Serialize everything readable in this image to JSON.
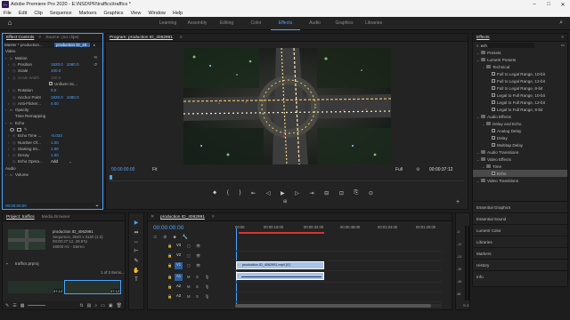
{
  "titlebar": {
    "logo": "Pr",
    "title": "Adobe Premiere Pro 2020 - E:\\NSD\\PR\\traffics\\traffics *",
    "min": "–",
    "max": "□",
    "close": "✕"
  },
  "menu": [
    "File",
    "Edit",
    "Clip",
    "Sequence",
    "Markers",
    "Graphics",
    "View",
    "Window",
    "Help"
  ],
  "workspaces": {
    "items": [
      "Learning",
      "Assembly",
      "Editing",
      "Color",
      "Effects",
      "Audio",
      "Graphics",
      "Libraries"
    ],
    "active": "Effects"
  },
  "effect_controls": {
    "tabs": [
      "Effect Controls",
      "Source: (no clips)"
    ],
    "menu_icon": "≡",
    "master_label": "Master * production...",
    "clip_label": "production ID_40...",
    "section_video": "Video",
    "motion": "Motion",
    "position": {
      "label": "Position",
      "x": "1920.0",
      "y": "1080.0"
    },
    "scale": {
      "label": "Scale",
      "value": "100.0"
    },
    "scale_width": {
      "label": "Scale Width",
      "value": "100.0"
    },
    "uniform_scale": "Uniform Sc...",
    "rotation": {
      "label": "Rotation",
      "value": "0.0"
    },
    "anchor": {
      "label": "Anchor Point",
      "x": "1920.0",
      "y": "1080.0"
    },
    "anti_flicker": {
      "label": "Anti-Flicker...",
      "value": "0.00"
    },
    "opacity": "Opacity",
    "time_remap": "Time Remapping",
    "echo": "Echo",
    "echo_time": {
      "label": "Echo Time ...",
      "value": "-0.033"
    },
    "num_echoes": {
      "label": "Number Of...",
      "value": "1.00"
    },
    "starting_int": {
      "label": "Starting Int...",
      "value": "1.00"
    },
    "decay": {
      "label": "Decay",
      "value": "1.00"
    },
    "echo_operator": {
      "label": "Echo Opera...",
      "value": "Add"
    },
    "section_audio": "Audio",
    "volume": "Volume",
    "timecode": "00:00:00:00"
  },
  "program": {
    "title": "Program: production ID_4062991",
    "menu_icon": "≡",
    "timecode_left": "00:00:00:00",
    "fit": "Fit",
    "quality": "Full",
    "timecode_right": "00:00:37:12",
    "transport": [
      "⬥",
      "{",
      "}",
      "⇤",
      "◁",
      "▶",
      "▷",
      "⇥",
      "⊟",
      "⊡",
      "⎘",
      "⊙"
    ],
    "extra": [
      "⊞",
      "+"
    ]
  },
  "effects_panel": {
    "title": "Effects",
    "menu_icon": "≡",
    "search_value": "ech",
    "rows": [
      {
        "depth": 0,
        "type": "folder",
        "label": "Presets"
      },
      {
        "depth": 0,
        "type": "folder",
        "label": "Lumetri Presets"
      },
      {
        "depth": 1,
        "type": "folder",
        "label": "Technical"
      },
      {
        "depth": 2,
        "type": "item",
        "label": "Full to Legal Range, 10-bit"
      },
      {
        "depth": 2,
        "type": "item",
        "label": "Full to Legal Range, 12-bit"
      },
      {
        "depth": 2,
        "type": "item",
        "label": "Full to Legal Range, 8-bit"
      },
      {
        "depth": 2,
        "type": "item",
        "label": "Legal to Full Range, 10-bit"
      },
      {
        "depth": 2,
        "type": "item",
        "label": "Legal to Full Range, 12-bit"
      },
      {
        "depth": 2,
        "type": "item",
        "label": "Legal to Full Range, 8-bit"
      },
      {
        "depth": 0,
        "type": "folder",
        "label": "Audio Effects"
      },
      {
        "depth": 1,
        "type": "folder",
        "label": "Delay and Echo"
      },
      {
        "depth": 2,
        "type": "item",
        "label": "Analog Delay"
      },
      {
        "depth": 2,
        "type": "item",
        "label": "Delay"
      },
      {
        "depth": 2,
        "type": "item",
        "label": "Multitap Delay"
      },
      {
        "depth": 0,
        "type": "folder",
        "label": "Audio Transitions"
      },
      {
        "depth": 0,
        "type": "folder",
        "label": "Video Effects"
      },
      {
        "depth": 1,
        "type": "folder",
        "label": "Time"
      },
      {
        "depth": 2,
        "type": "item",
        "label": "Echo",
        "selected": true
      },
      {
        "depth": 0,
        "type": "folder",
        "label": "Video Transitions"
      }
    ],
    "collapsed_panels": [
      "Essential Graphics",
      "Essential Sound",
      "Lumetri Color",
      "Libraries",
      "Markers",
      "History",
      "Info"
    ]
  },
  "project": {
    "tabs": [
      "Project: traffics",
      "Media Browser"
    ],
    "clip_name": "production ID_4062991",
    "clip_meta1": "Sequence, 3840 x 2160 (1.0)",
    "clip_meta2": "00:00:37:12, 29.97p",
    "clip_meta3": "48000 Hz - Stereo",
    "project_file": "traffics.prproj",
    "items_count": "1 of 2 Items...",
    "thumb1_dur": "37:12",
    "thumb2_dur": "37:12"
  },
  "timeline": {
    "tab": "production ID_4062991",
    "timecode": "00:00:00:00",
    "ruler": [
      "00:00",
      "00:00:16:00",
      "00:00:32:00",
      "00:00:48:00",
      "00:01:04:00",
      "00:01:20:00"
    ],
    "video_tracks": [
      "V3",
      "V2",
      "V1"
    ],
    "audio_tracks": [
      "A1",
      "A2",
      "A3"
    ],
    "video_clip_label": "production ID_4062991.mp4 [V]",
    "audio_clip_label": "",
    "db_scale": [
      "-0",
      "-12",
      "-24",
      "-36",
      "-48",
      "dB"
    ]
  },
  "tools": [
    "▶",
    "⇹",
    "↔",
    "⊢",
    "✎",
    "✋",
    "T"
  ],
  "colors": {
    "accent": "#4ba3ff",
    "video_clip": "#a8c3ea",
    "audio_clip": "#a8c3ea"
  }
}
